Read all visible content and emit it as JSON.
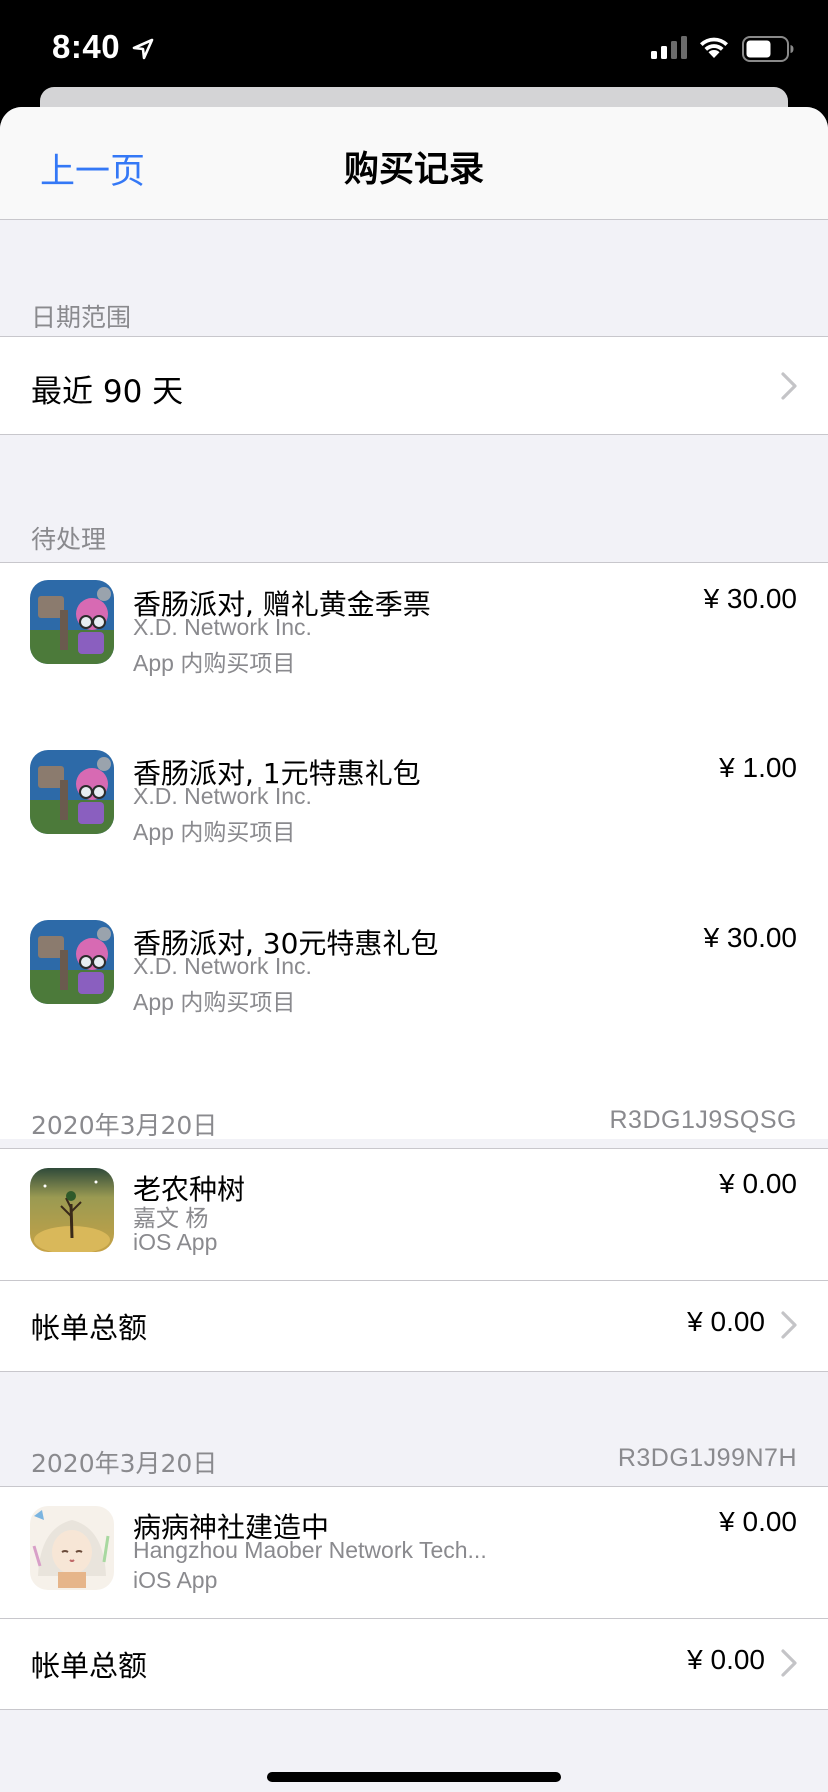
{
  "status_bar": {
    "time": "8:40"
  },
  "nav": {
    "back_label": "上一页",
    "title": "购买记录"
  },
  "date_range": {
    "header": "日期范围",
    "value": "最近 90 天"
  },
  "pending": {
    "header": "待处理",
    "items": [
      {
        "title": "香肠派对, 赠礼黄金季票",
        "developer": "X.D. Network Inc.",
        "type": "App 内购买项目",
        "price": "¥ 30.00"
      },
      {
        "title": "香肠派对, 1元特惠礼包",
        "developer": "X.D. Network Inc.",
        "type": "App 内购买项目",
        "price": "¥ 1.00"
      },
      {
        "title": "香肠派对, 30元特惠礼包",
        "developer": "X.D. Network Inc.",
        "type": "App 内购买项目",
        "price": "¥ 30.00"
      }
    ]
  },
  "receipts": [
    {
      "date": "2020年3月20日",
      "order_id": "R3DG1J9SQSG",
      "item": {
        "title": "老农种树",
        "developer": "嘉文 杨",
        "type": "iOS App",
        "price": "¥ 0.00"
      },
      "total_label": "帐单总额",
      "total": "¥ 0.00"
    },
    {
      "date": "2020年3月20日",
      "order_id": "R3DG1J99N7H",
      "item": {
        "title": "病病神社建造中",
        "developer": "Hangzhou Maober Network Tech...",
        "type": "iOS App",
        "price": "¥ 0.00"
      },
      "total_label": "帐单总额",
      "total": "¥ 0.00"
    }
  ],
  "icons": {
    "location": "location-arrow-icon",
    "signal": "cellular-signal-icon",
    "wifi": "wifi-icon",
    "battery": "battery-icon",
    "chevron": "chevron-right-icon"
  },
  "colors": {
    "accent": "#3478f6",
    "secondary_text": "#8a8a8e",
    "background": "#f2f2f7"
  }
}
